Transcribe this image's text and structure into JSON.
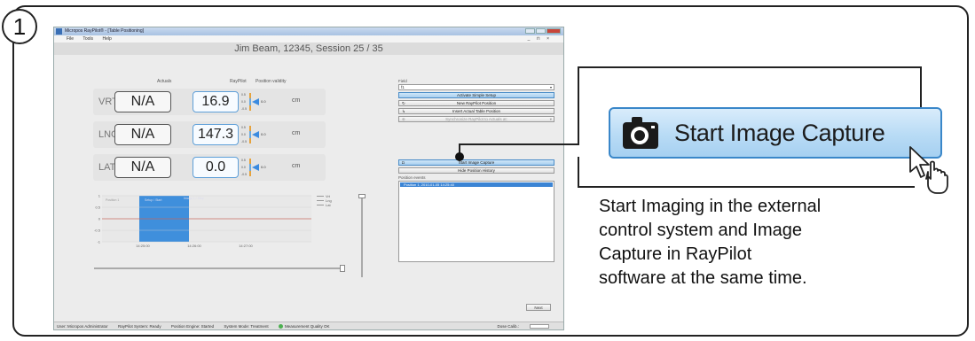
{
  "step": {
    "number": "1"
  },
  "app": {
    "title": "Micropos RayPilot® - [Table Positioning]",
    "menu": [
      "File",
      "Tools",
      "Help"
    ],
    "mdi_controls": "_ ⊓ ×",
    "session": "Jim Beam, 12345, Session 25 / 35"
  },
  "columns": {
    "actuals": "Actuals",
    "raypilot": "RayPilot",
    "validity": "Position validity"
  },
  "rows": [
    {
      "axis": "VRT",
      "actual": "N/A",
      "raypilot": "16.9",
      "unit": "cm",
      "scale_top": "0.5",
      "scale_mid": "0.0",
      "scale_bot": "-0.5",
      "zero": "0.0"
    },
    {
      "axis": "LNG",
      "actual": "N/A",
      "raypilot": "147.3",
      "unit": "cm",
      "scale_top": "0.5",
      "scale_mid": "0.0",
      "scale_bot": "-0.5",
      "zero": "0.0"
    },
    {
      "axis": "LAT",
      "actual": "N/A",
      "raypilot": "0.0",
      "unit": "cm",
      "scale_top": "0.5",
      "scale_mid": "0.0",
      "scale_bot": "-0.5",
      "zero": "0.0"
    }
  ],
  "chart_data": {
    "type": "line",
    "title": "",
    "ylim": [
      -1,
      1
    ],
    "yticks": [
      "1",
      "0.5",
      "0",
      "-0.5",
      "-1"
    ],
    "xticks": [
      "14:25:00",
      "14:26:00",
      "14:27:00"
    ],
    "series": [
      {
        "name": "Vrt",
        "values": [
          0,
          0,
          0
        ]
      },
      {
        "name": "Lng",
        "values": [
          0,
          0,
          0
        ]
      },
      {
        "name": "Lat",
        "values": [
          0,
          0,
          0
        ]
      }
    ],
    "annotations": [
      "Position 1",
      "Setup / Start",
      "Image 1 / Stop"
    ],
    "highlight_color": "#3f8fdc",
    "legend": "right"
  },
  "panel": {
    "field_label": "Field",
    "field_value": "f1",
    "btn_activate": "Activate Simple Setup",
    "btn_new_pos": "New RayPilot Position",
    "btn_insert": "Insert Actual Table Position",
    "btn_sync": "Synchronize RayPilot to Actuals at:",
    "btn_capture": "Start Image Capture",
    "btn_hide": "Hide Position History",
    "events_label": "Position events",
    "event_1": "Position 1, 2010-01-05 14:25:40",
    "next": "Next"
  },
  "status": {
    "user": "User: Micropos Administrator",
    "system": "RayPilot System: Ready",
    "engine": "Position Engine: Started",
    "mode": "System Mode: Treatment",
    "quality": "Measurement Quality OK",
    "dose": "Dose Calib.:"
  },
  "callout": {
    "button_label": "Start Image Capture",
    "description": [
      "Start Imaging in the external",
      "control system and Image",
      "Capture in RayPilot",
      "software at the same time."
    ]
  },
  "colors": {
    "accent": "#3a87c9",
    "event_highlight": "#3b84d4"
  }
}
